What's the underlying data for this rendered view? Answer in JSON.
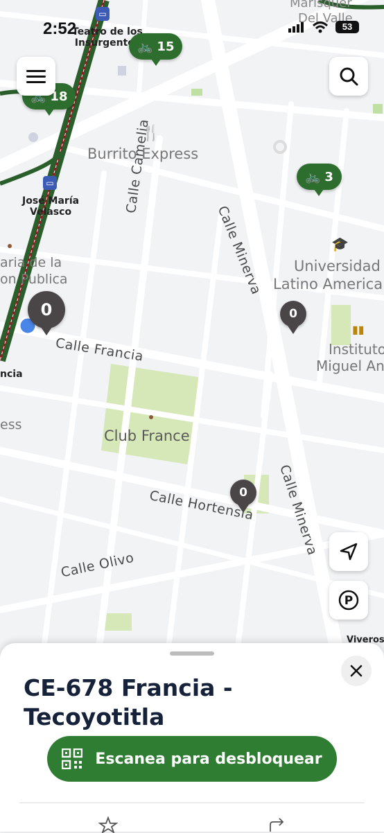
{
  "status_bar": {
    "time": "2:52",
    "battery": "53"
  },
  "map": {
    "streets": [
      "Calle Camelia",
      "Calle Minerva",
      "Calle Minerva",
      "Calle Francia",
      "Calle Hortensia",
      "Calle Olivo"
    ],
    "places": {
      "burrito": "Burrito Express",
      "club": "Club France",
      "univ1": "Universidad",
      "univ2": "Latino America",
      "inst1": "Instituto",
      "inst2": "Miguel Ang",
      "left1": "aria de la",
      "left2": "on Publica",
      "left3": "ess",
      "marisq1": "Marisquer",
      "marisq2": "Del Valle"
    },
    "stations": {
      "insurgentes1": "Teatro de los",
      "insurgentes2": "Insurgentes",
      "jose1": "José María",
      "jose2": "Velasco",
      "francia": "ncia",
      "viveros": "Viveros"
    },
    "bike_pins": [
      {
        "count": "15"
      },
      {
        "count": "18"
      },
      {
        "count": "3"
      }
    ],
    "dock_pins": [
      {
        "count": "0"
      },
      {
        "count": "0"
      },
      {
        "count": "0"
      }
    ]
  },
  "sheet": {
    "title": "CE-678 Francia - Tecoyotitla",
    "scan_label": "Escanea para desbloquear"
  },
  "colors": {
    "brand": "#2f7d32",
    "pin_green": "#2d6e2f",
    "pin_gray": "#4a4546"
  }
}
